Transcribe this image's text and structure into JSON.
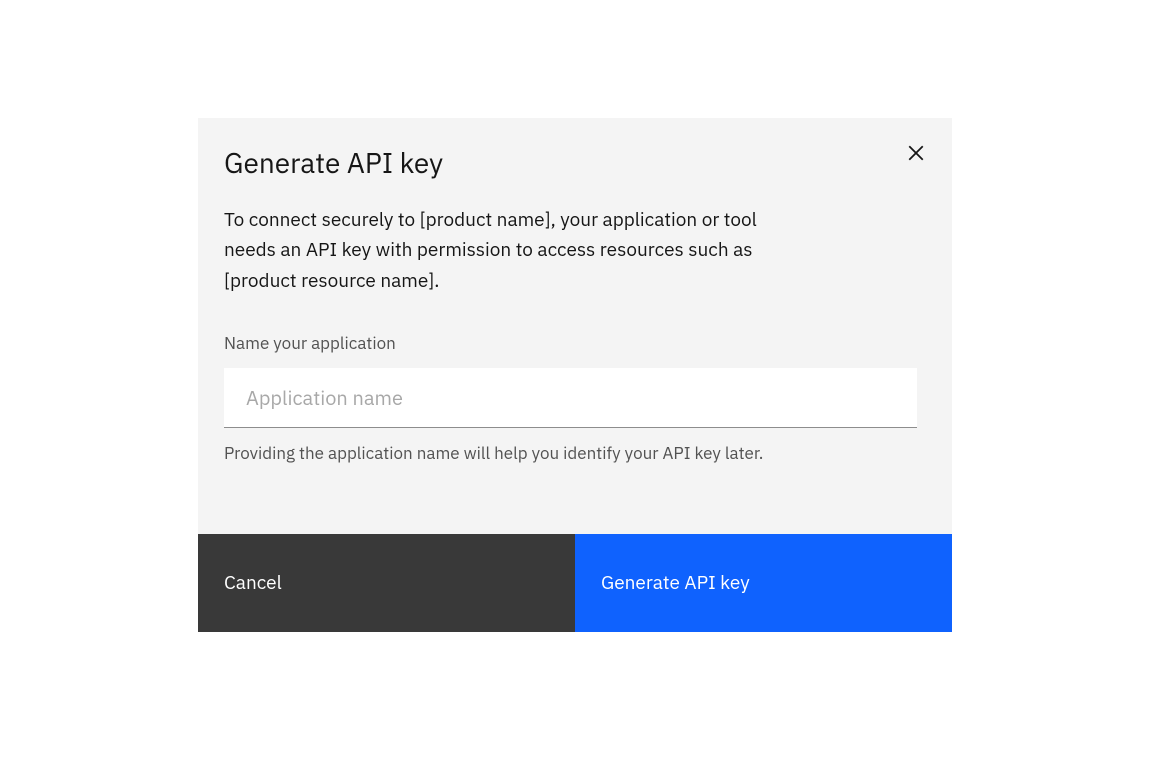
{
  "modal": {
    "title": "Generate API key",
    "description": "To connect securely to [product name], your application or tool needs an API key with permission to access resources such as [product resource name].",
    "field_label": "Name your application",
    "input_placeholder": "Application name",
    "input_value": "",
    "helper_text": "Providing the application name will help you identify your API key later.",
    "cancel_label": "Cancel",
    "submit_label": "Generate API key"
  }
}
